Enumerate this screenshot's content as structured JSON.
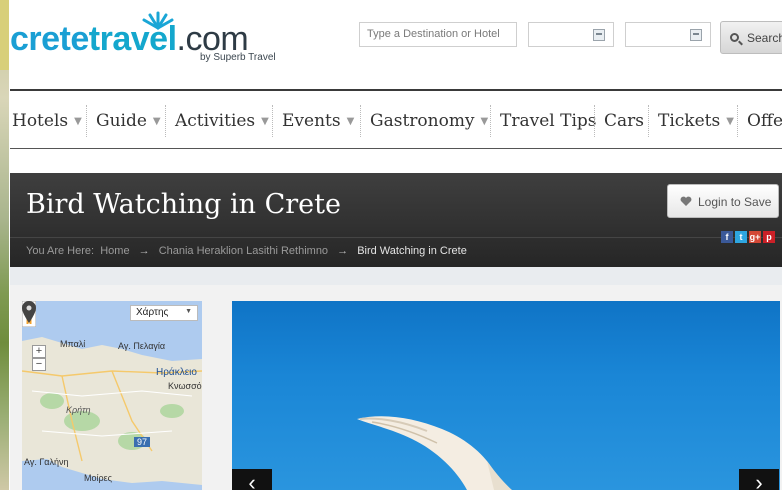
{
  "logo": {
    "crete": "crete",
    "travel": "travel",
    "com": ".com",
    "sub": "by Superb Travel"
  },
  "search": {
    "placeholder": "Type a Destination or Hotel",
    "button_label": "Search"
  },
  "nav": {
    "items": [
      {
        "label": "Hotels",
        "dropdown": true
      },
      {
        "label": "Guide",
        "dropdown": true
      },
      {
        "label": "Activities",
        "dropdown": true
      },
      {
        "label": "Events",
        "dropdown": true
      },
      {
        "label": "Gastronomy",
        "dropdown": true
      },
      {
        "label": "Travel Tips",
        "dropdown": false
      },
      {
        "label": "Cars",
        "dropdown": false
      },
      {
        "label": "Tickets",
        "dropdown": true
      },
      {
        "label": "Offers",
        "dropdown": false
      }
    ]
  },
  "page": {
    "title": "Bird Watching in Crete",
    "login_label": "Login to Save"
  },
  "breadcrumb": {
    "prefix": "You Are Here:",
    "home": "Home",
    "region": "Chania Heraklion Lasithi Rethimno",
    "current": "Bird Watching in Crete",
    "arrow": "→"
  },
  "social": [
    "f",
    "t",
    "g+",
    "p"
  ],
  "map": {
    "type_label": "Χάρτης",
    "zoom_in": "+",
    "zoom_out": "−",
    "labels": {
      "mpali": "Μπαλί",
      "agia_pelagia": "Αγ. Πελαγία",
      "heraklion": "Ηράκλειο",
      "knossos": "Κνωσσός",
      "kriti": "Κρήτη",
      "road": "97",
      "agia_galini": "Αγ. Γαλήνη",
      "moires": "Μοίρες"
    }
  },
  "gallery": {
    "prev": "‹",
    "next": "›"
  },
  "colors": {
    "brand_blue": "#1a9fd4",
    "title_bar": "#2f2f2f",
    "sky": "#1a86d6"
  }
}
